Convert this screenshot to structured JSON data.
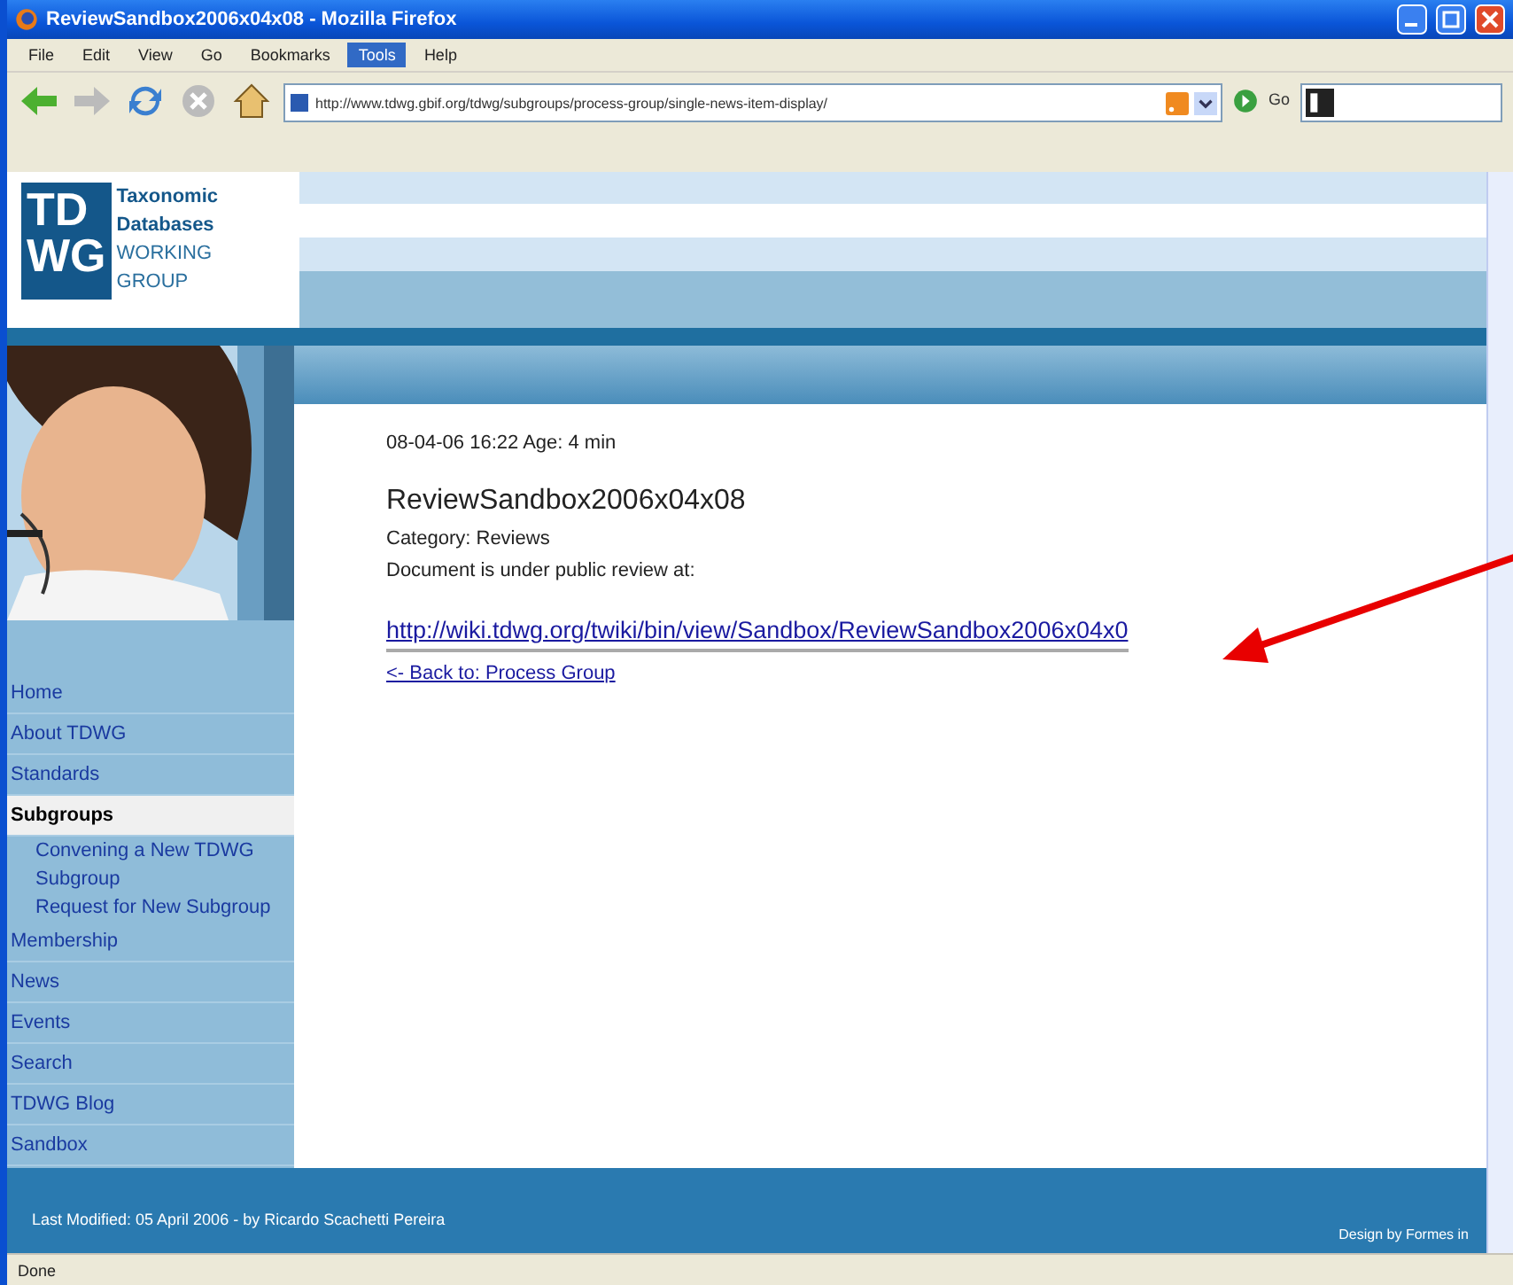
{
  "window": {
    "title": "ReviewSandbox2006x04x08 - Mozilla Firefox"
  },
  "menu": [
    {
      "label": "File",
      "selected": false
    },
    {
      "label": "Edit",
      "selected": false
    },
    {
      "label": "View",
      "selected": false
    },
    {
      "label": "Go",
      "selected": false
    },
    {
      "label": "Bookmarks",
      "selected": false
    },
    {
      "label": "Tools",
      "selected": true
    },
    {
      "label": "Help",
      "selected": false
    }
  ],
  "toolbar": {
    "address": "http://www.tdwg.gbif.org/tdwg/subgroups/process-group/single-news-item-display/",
    "go": "Go"
  },
  "logo": {
    "mark_top": "TD",
    "mark_bottom": "WG",
    "lines": [
      "Taxonomic",
      "Databases",
      "WORKING",
      "GROUP"
    ]
  },
  "sidebar": {
    "items": [
      {
        "label": "Home",
        "selected": false
      },
      {
        "label": "About TDWG",
        "selected": false
      },
      {
        "label": "Standards",
        "selected": false
      },
      {
        "label": "Subgroups",
        "selected": true,
        "children": [
          {
            "label": "Convening a New TDWG Subgroup"
          },
          {
            "label": "Request for New Subgroup"
          }
        ]
      },
      {
        "label": "Membership",
        "selected": false
      },
      {
        "label": "News",
        "selected": false
      },
      {
        "label": "Events",
        "selected": false
      },
      {
        "label": "Search",
        "selected": false
      },
      {
        "label": "TDWG Blog",
        "selected": false
      },
      {
        "label": "Sandbox",
        "selected": false
      }
    ]
  },
  "article": {
    "meta": "08-04-06 16:22 Age: 4 min",
    "title": "ReviewSandbox2006x04x08",
    "category": "Category: Reviews",
    "text": "Document is under public review at:",
    "link": "http://wiki.tdwg.org/twiki/bin/view/Sandbox/ReviewSandbox2006x04x0",
    "back": "<- Back to: Process Group"
  },
  "footer": {
    "modified": "Last Modified: 05 April 2006 - by Ricardo Scachetti Pereira",
    "credit": "Design by Formes in"
  },
  "status_bar": "Done"
}
